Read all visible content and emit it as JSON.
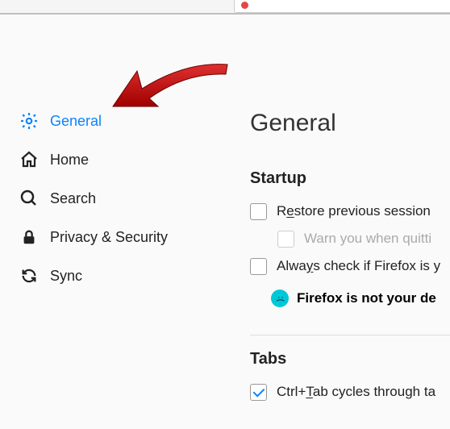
{
  "sidebar": {
    "items": [
      {
        "label": "General"
      },
      {
        "label": "Home"
      },
      {
        "label": "Search"
      },
      {
        "label": "Privacy & Security"
      },
      {
        "label": "Sync"
      }
    ]
  },
  "content": {
    "pageTitle": "General",
    "startup": {
      "title": "Startup",
      "restoreLabel_pre": "R",
      "restoreLabel_u": "e",
      "restoreLabel_post": "store previous session",
      "warnLabel": "Warn you when quitti",
      "alwaysLabel_pre": "Alwa",
      "alwaysLabel_u": "y",
      "alwaysLabel_post": "s check if Firefox is y",
      "notDefaultText": "Firefox is not your de"
    },
    "tabs": {
      "title": "Tabs",
      "ctrlTabLabel_pre": "Ctrl+",
      "ctrlTabLabel_u": "T",
      "ctrlTabLabel_post": "ab cycles through ta"
    }
  }
}
